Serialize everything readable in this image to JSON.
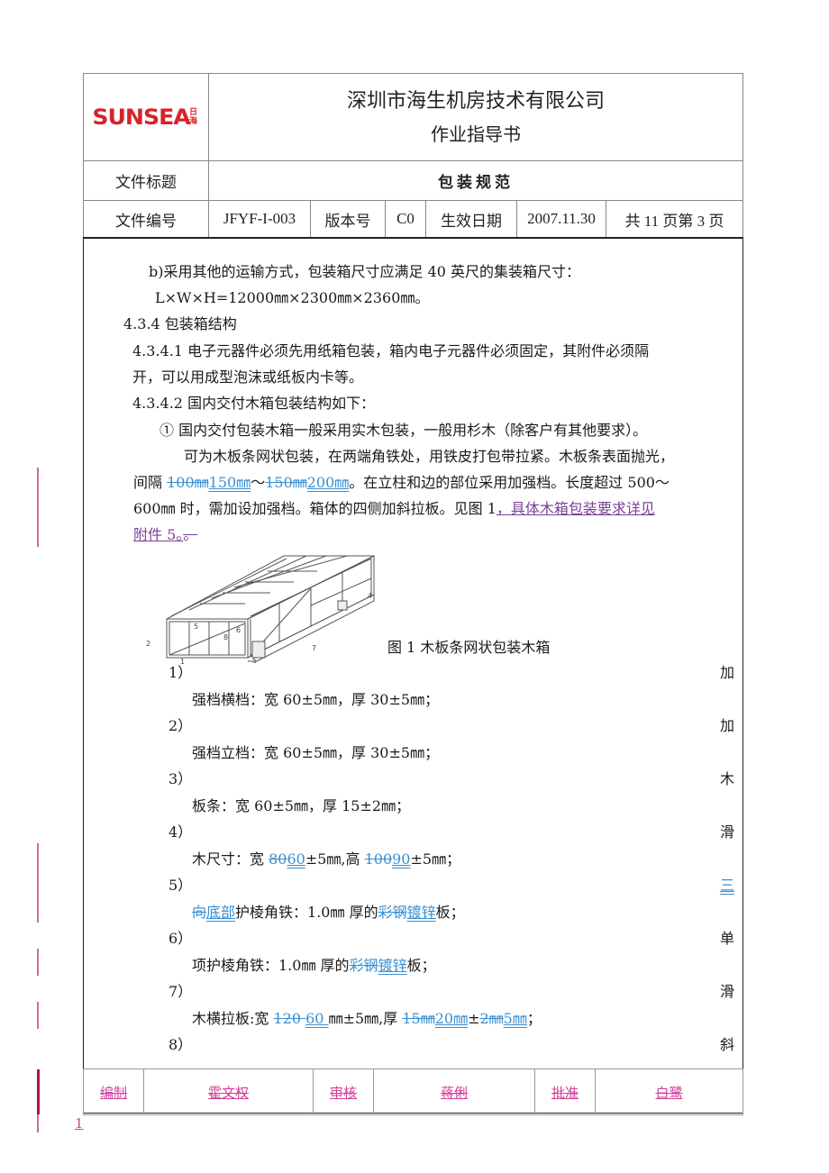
{
  "header": {
    "logo": {
      "text": "SUNSEA",
      "cn_chars": [
        "日",
        "海"
      ],
      "color": "#d8232a"
    },
    "company": "深圳市海生机房技术有限公司",
    "doc_type": "作业指导书",
    "title_label": "文件标题",
    "title_value": "包装规范",
    "doc_no_label": "文件编号",
    "doc_no_value": "JFYF-I-003",
    "version_label": "版本号",
    "version_value": "C0",
    "effective_label": "生效日期",
    "effective_value": "2007.11.30",
    "pages": "共 11 页第 3 页"
  },
  "body": {
    "p1": "b)采用其他的运输方式，包装箱尺寸应满足 40 英尺的集装箱尺寸：",
    "p2": "L×W×H=12000㎜×2300㎜×2360㎜。",
    "p3": "4.3.4 包装箱结构",
    "p4a": "4.3.4.1 电子元器件必须先用纸箱包装，箱内电子元器件必须固定，其附件必须隔",
    "p4b": "开，可以用成型泡沫或纸板内卡等。",
    "p5": "4.3.4.2 国内交付木箱包装结构如下：",
    "p6": "① 国内交付包装木箱一般采用实木包装，一般用杉木（除客户有其他要求）。",
    "p7": "可为木板条网状包装，在两端角铁处，用铁皮打包带拉紧。木板条表面抛光，",
    "p8_pre": "间隔 ",
    "p8_del1": "100㎜",
    "p8_ins1": "150㎜",
    "p8_tilde": "～",
    "p8_del2": "150㎜",
    "p8_ins2": "200㎜",
    "p8_post": "。在立柱和边的部位采用加强档。长度超过 500～",
    "p9_pre": "600㎜ 时，需加设加强档。箱体的四侧加斜拉板。见图 1",
    "p9_link": "，具体木箱包装要求详见",
    "p10_link": "附件 5。",
    "p10_del": "。",
    "figure_caption": "图 1  木板条网状包装木箱",
    "figure_labels": [
      "1",
      "2",
      "3",
      "4",
      "5",
      "6",
      "7",
      "8",
      "5"
    ],
    "items": [
      {
        "num": "1）",
        "right": "加",
        "text": "强档横档：宽 60±5㎜，厚 30±5㎜；"
      },
      {
        "num": "2）",
        "right": "加",
        "text": "强档立档：宽 60±5㎜，厚 30±5㎜；"
      },
      {
        "num": "3）",
        "right": "木",
        "text": "板条：宽 60±5㎜，厚 15±2㎜；"
      },
      {
        "num": "4）",
        "right": "滑",
        "text_pre": "木尺寸：宽 ",
        "del1": "80",
        "ins1": "60",
        "mid": "±5㎜,高 ",
        "del2": "100",
        "ins2": "90",
        "post": "±5㎜；"
      },
      {
        "num": "5）",
        "right": "三",
        "del1": "向",
        "ins1": "底部",
        "mid": "护棱角铁：1.0㎜ 厚的",
        "del2": "彩钢",
        "ins2": "镀锌",
        "post": "板；"
      },
      {
        "num": "6）",
        "right": "单",
        "text_pre": "项护棱角铁：1.0㎜ 厚的",
        "del1": "彩钢",
        "ins1": "镀锌",
        "post": "板；"
      },
      {
        "num": "7）",
        "right": "滑",
        "text_pre": "木横拉板:宽 ",
        "del1": "120 ",
        "ins1": "60 ",
        "mid": "㎜±5㎜,厚 ",
        "del2": "15㎜",
        "ins2": "20㎜",
        "pm": "±",
        "del3": "2㎜",
        "ins3": "5㎜",
        "post": "；"
      },
      {
        "num": "8）",
        "right": "斜"
      }
    ]
  },
  "footer": {
    "cells": [
      "编制",
      "霍文权",
      "审核",
      "蒋俐",
      "批准",
      "白鹭"
    ],
    "page_number": "1",
    "color": "#d0419a"
  }
}
